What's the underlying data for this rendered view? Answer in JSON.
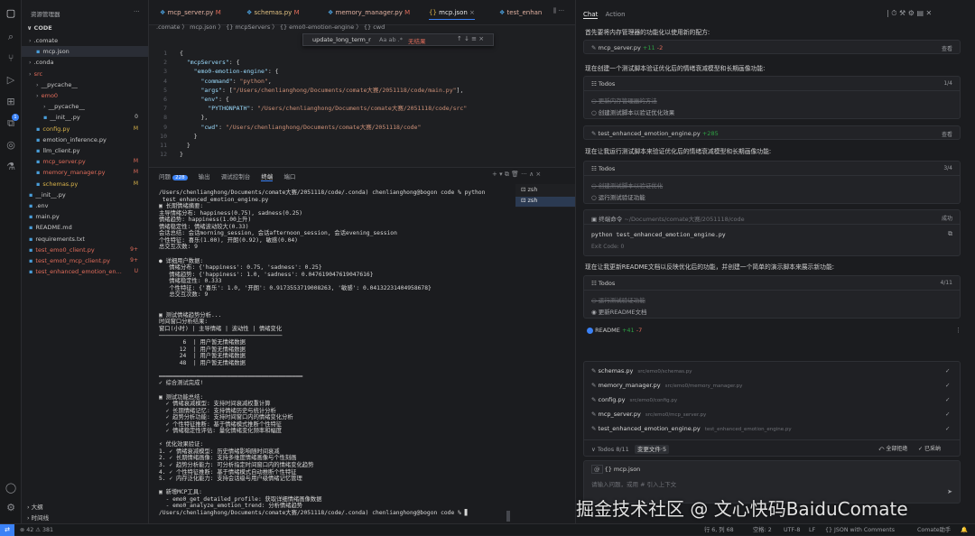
{
  "explorer": {
    "title": "资源管理器",
    "root": "CODE",
    "items": [
      {
        "label": ".comate",
        "indent": 0,
        "color": "#c8c8c8",
        "badge": ""
      },
      {
        "label": "mcp.json",
        "indent": 1,
        "color": "#c8c8c8",
        "badge": ""
      },
      {
        "label": ".conda",
        "indent": 0,
        "color": "#c8c8c8",
        "badge": ""
      },
      {
        "label": "src",
        "indent": 0,
        "color": "#e06c5a",
        "badge": ""
      },
      {
        "label": "__pycache__",
        "indent": 1,
        "color": "#c8c8c8",
        "badge": ""
      },
      {
        "label": "emo0",
        "indent": 1,
        "color": "#e06c5a",
        "badge": ""
      },
      {
        "label": "__pycache__",
        "indent": 2,
        "color": "#c8c8c8",
        "badge": ""
      },
      {
        "label": "__init__.py",
        "indent": 2,
        "color": "#c8c8c8",
        "badge": "0"
      },
      {
        "label": "config.py",
        "indent": 1,
        "color": "#d9b34a",
        "badge": "M"
      },
      {
        "label": "emotion_inference.py",
        "indent": 1,
        "color": "#c8c8c8",
        "badge": ""
      },
      {
        "label": "llm_client.py",
        "indent": 1,
        "color": "#c8c8c8",
        "badge": ""
      },
      {
        "label": "mcp_server.py",
        "indent": 1,
        "color": "#e06c5a",
        "badge": "M"
      },
      {
        "label": "memory_manager.py",
        "indent": 1,
        "color": "#e06c5a",
        "badge": "M"
      },
      {
        "label": "schemas.py",
        "indent": 1,
        "color": "#d9b34a",
        "badge": "M"
      },
      {
        "label": "__init__.py",
        "indent": 0,
        "color": "#c8c8c8",
        "badge": ""
      },
      {
        "label": ".env",
        "indent": 0,
        "color": "#c8c8c8",
        "badge": ""
      },
      {
        "label": "main.py",
        "indent": 0,
        "color": "#c8c8c8",
        "badge": ""
      },
      {
        "label": "README.md",
        "indent": 0,
        "color": "#c8c8c8",
        "badge": ""
      },
      {
        "label": "requirements.txt",
        "indent": 0,
        "color": "#c8c8c8",
        "badge": ""
      },
      {
        "label": "test_emo0_client.py",
        "indent": 0,
        "color": "#e06c5a",
        "badge": "9+"
      },
      {
        "label": "test_emo0_mcp_client.py",
        "indent": 0,
        "color": "#e06c5a",
        "badge": "9+"
      },
      {
        "label": "test_enhanced_emotion_en...",
        "indent": 0,
        "color": "#e06c5a",
        "badge": "U"
      }
    ],
    "outline": "大纲",
    "timeline": "时间线"
  },
  "tabs": [
    {
      "label": "mcp_server.py",
      "mod": "M",
      "active": false
    },
    {
      "label": "schemas.py",
      "mod": "M",
      "active": false
    },
    {
      "label": "memory_manager.py",
      "mod": "M",
      "active": false
    },
    {
      "label": "mcp.json",
      "mod": "",
      "active": true
    },
    {
      "label": "test_enhan",
      "mod": "",
      "active": false
    }
  ],
  "breadcrumb": ".comate 〉 mcp.json 〉 {} mcpServers 〉 {} emo0-emotion-engine 〉 {} cwd",
  "find": {
    "value": "update_long_term_r",
    "result": "无结果"
  },
  "code": [
    {
      "n": "1",
      "segs": [
        [
          "p",
          "{"
        ]
      ]
    },
    {
      "n": "2",
      "segs": [
        [
          "p",
          "  "
        ],
        [
          "k",
          "\"mcpServers\""
        ],
        [
          "p",
          ": {"
        ]
      ]
    },
    {
      "n": "3",
      "segs": [
        [
          "p",
          "    "
        ],
        [
          "k",
          "\"emo0-emotion-engine\""
        ],
        [
          "p",
          ": {"
        ]
      ]
    },
    {
      "n": "4",
      "segs": [
        [
          "p",
          "      "
        ],
        [
          "k",
          "\"command\""
        ],
        [
          "p",
          ": "
        ],
        [
          "s",
          "\"python\""
        ],
        [
          "p",
          ","
        ]
      ]
    },
    {
      "n": "5",
      "segs": [
        [
          "p",
          "      "
        ],
        [
          "k",
          "\"args\""
        ],
        [
          "p",
          ": ["
        ],
        [
          "s",
          "\"/Users/chenlianghong/Documents/comate大赛/2051118/code/main.py\""
        ],
        [
          "p",
          "],"
        ]
      ]
    },
    {
      "n": "6",
      "segs": [
        [
          "p",
          "      "
        ],
        [
          "k",
          "\"env\""
        ],
        [
          "p",
          ": {"
        ]
      ]
    },
    {
      "n": "7",
      "segs": [
        [
          "p",
          "        "
        ],
        [
          "k",
          "\"PYTHONPATH\""
        ],
        [
          "p",
          ": "
        ],
        [
          "s",
          "\"/Users/chenlianghong/Documents/comate大赛/2051118/code/src\""
        ]
      ]
    },
    {
      "n": "8",
      "segs": [
        [
          "p",
          "      },"
        ]
      ]
    },
    {
      "n": "9",
      "segs": [
        [
          "p",
          "      "
        ],
        [
          "k",
          "\"cwd\""
        ],
        [
          "p",
          ": "
        ],
        [
          "s",
          "\"/Users/chenlianghong/Documents/comate大赛/2051118/code\""
        ]
      ]
    },
    {
      "n": "10",
      "segs": [
        [
          "p",
          "    }"
        ]
      ]
    },
    {
      "n": "11",
      "segs": [
        [
          "p",
          "  }"
        ]
      ]
    },
    {
      "n": "12",
      "segs": [
        [
          "p",
          "}"
        ]
      ]
    }
  ],
  "panel": {
    "tabs": [
      "问题",
      "输出",
      "调试控制台",
      "终端",
      "端口"
    ],
    "problems_count": "228",
    "active_tab": "终端",
    "shells": [
      "zsh",
      "zsh"
    ],
    "lines": [
      "/Users/chenlianghong/Documents/comate大赛/2051118/code/.conda) chenlianghong@bogon code % python",
      " test_enhanced_emotion_engine.py",
      "▣ 长期情绪摘要:",
      "主导情绪分布: happiness(0.75), sadness(0.25)",
      "情绪趋势: happiness(1.00上升)",
      "情绪稳定性: 情绪波动较大(0.33)",
      "会话总结: 会话morning_session, 会话afternoon_session, 会话evening_session",
      "个性特征: 喜乐(1.00), 开朗(0.92), 敏感(0.04)",
      "总交互次数: 9",
      "",
      "● 详细用户数据:",
      "   情绪分布: {'happiness': 0.75, 'sadness': 0.25}",
      "   情绪趋势: {'happiness': 1.0, 'sadness': 0.047619047619047616}",
      "   情绪稳定性: 0.333",
      "   个性特征: {'喜乐': 1.0, '开朗': 0.9173553719008263, '敏感': 0.04132231404958678}",
      "   总交互次数: 9",
      "",
      "",
      "▣ 测试情绪趋势分析...",
      "时间窗口分析结果:",
      "窗口(小时) | 主导情绪 | 波动性 | 情绪变化",
      "────────────────────────────────────",
      "       6  | 用户暂无情绪数据",
      "      12  | 用户暂无情绪数据",
      "      24  | 用户暂无情绪数据",
      "      48  | 用户暂无情绪数据",
      "",
      "══════════════════════════════════════════",
      "✓ 综合测试完成!",
      "",
      "▣ 测试功能总结:",
      "  ✓ 情绪衰减模型: 支持时间衰减权重计算",
      "  ✓ 长期情绪记忆: 支持情绪历史与统计分析",
      "  ✓ 趋势分析功能: 支持时间窗口内的情绪变化分析",
      "  ✓ 个性特征推断: 基于情绪模式推断个性特征",
      "  ✓ 情绪稳定性评估: 量化情绪变化频率和幅度",
      "",
      "⚡ 优化效果验证:",
      "1. ✓ 情绪衰减模型: 历史情绪影响随时间衰减",
      "2. ✓ 长期情绪画像: 支持多维度情绪画像与个性刻画",
      "3. ✓ 趋势分析能力: 可分析指定时间窗口内的情绪变化趋势",
      "4. ✓ 个性特征推断: 基于情绪模式自动推断个性特征",
      "5. ✓ 内存泛化能力: 支持会话级与用户级情绪记忆管理",
      "",
      "▣ 新增MCP工具:",
      "  - emo0_get_detailed_profile: 获取详细情绪画像数据",
      "  - emo0_analyze_emotion_trend: 分析情绪趋势",
      "/Users/chenlianghong/Documents/comate大赛/2051118/code/.conda) chenlianghong@bogon code % ▊"
    ]
  },
  "chat": {
    "tabs": [
      "Chat",
      "Action"
    ],
    "msg1": "首先要将内存管理器的功能化以使用新的配方:",
    "file1": {
      "name": "mcp_server.py",
      "add": "+11",
      "del": "-2",
      "action": "查看"
    },
    "msg2": "现在创建一个测试脚本验证优化后的情绪衰减模型和长期画像功能:",
    "todos1": {
      "title": "Todos",
      "count": "1/4",
      "items": [
        "更新内存管理器的方法",
        "创建测试脚本以验证优化效果"
      ]
    },
    "file2": {
      "name": "test_enhanced_emotion_engine.py",
      "add": "+285",
      "action": "查看"
    },
    "msg3": "现在让我运行测试脚本来验证优化后的情绪衰减模型和长期画像功能:",
    "todos2": {
      "title": "Todos",
      "count": "3/4",
      "items": [
        "创建测试脚本以验证优化",
        "运行测试验证功能"
      ]
    },
    "cmd": {
      "title": "终端命令",
      "path": "~/Documents/comate大赛/2051118/code",
      "status": "成功",
      "command": "python test_enhanced_emotion_engine.py",
      "exit": "Exit Code: 0"
    },
    "msg4": "现在让我更新README文档以反映优化后的功能，并创建一个简单的演示脚本来展示新功能:",
    "todos3": {
      "title": "Todos",
      "count": "4/11",
      "items": [
        "运行测试验证功能",
        "更新README文档"
      ]
    },
    "file3": {
      "name": "README",
      "add": "+41",
      "del": "-7"
    },
    "changed": [
      {
        "name": "schemas.py",
        "path": "src/emo0/schemas.py"
      },
      {
        "name": "memory_manager.py",
        "path": "src/emo0/memory_manager.py"
      },
      {
        "name": "config.py",
        "path": "src/emo0/config.py"
      },
      {
        "name": "mcp_server.py",
        "path": "src/emo0/mcp_server.py"
      },
      {
        "name": "test_enhanced_emotion_engine.py",
        "path": "test_enhanced_emotion_engine.py"
      }
    ],
    "summary": {
      "todos": "Todos 8/11",
      "files": "变更文件·5",
      "reject": "全部拒绝",
      "accept": "已采纳"
    },
    "input": {
      "mention": "{} mcp.json",
      "placeholder": "请输入问题，或用 # 引入上下文"
    }
  },
  "watermark": "掘金技术社区 @ 文心快码BaiduComate",
  "status": {
    "left": "⊗ 42 ⚠ 381",
    "position": "行 6, 列 68",
    "spaces": "空格: 2",
    "encoding": "UTF-8",
    "eol": "LF",
    "language": "{} JSON with Comments",
    "ext": "Comate助手"
  },
  "colors": {
    "accent": "#3b82f6",
    "success": "#2ea043",
    "modified": "#e06c5a"
  }
}
